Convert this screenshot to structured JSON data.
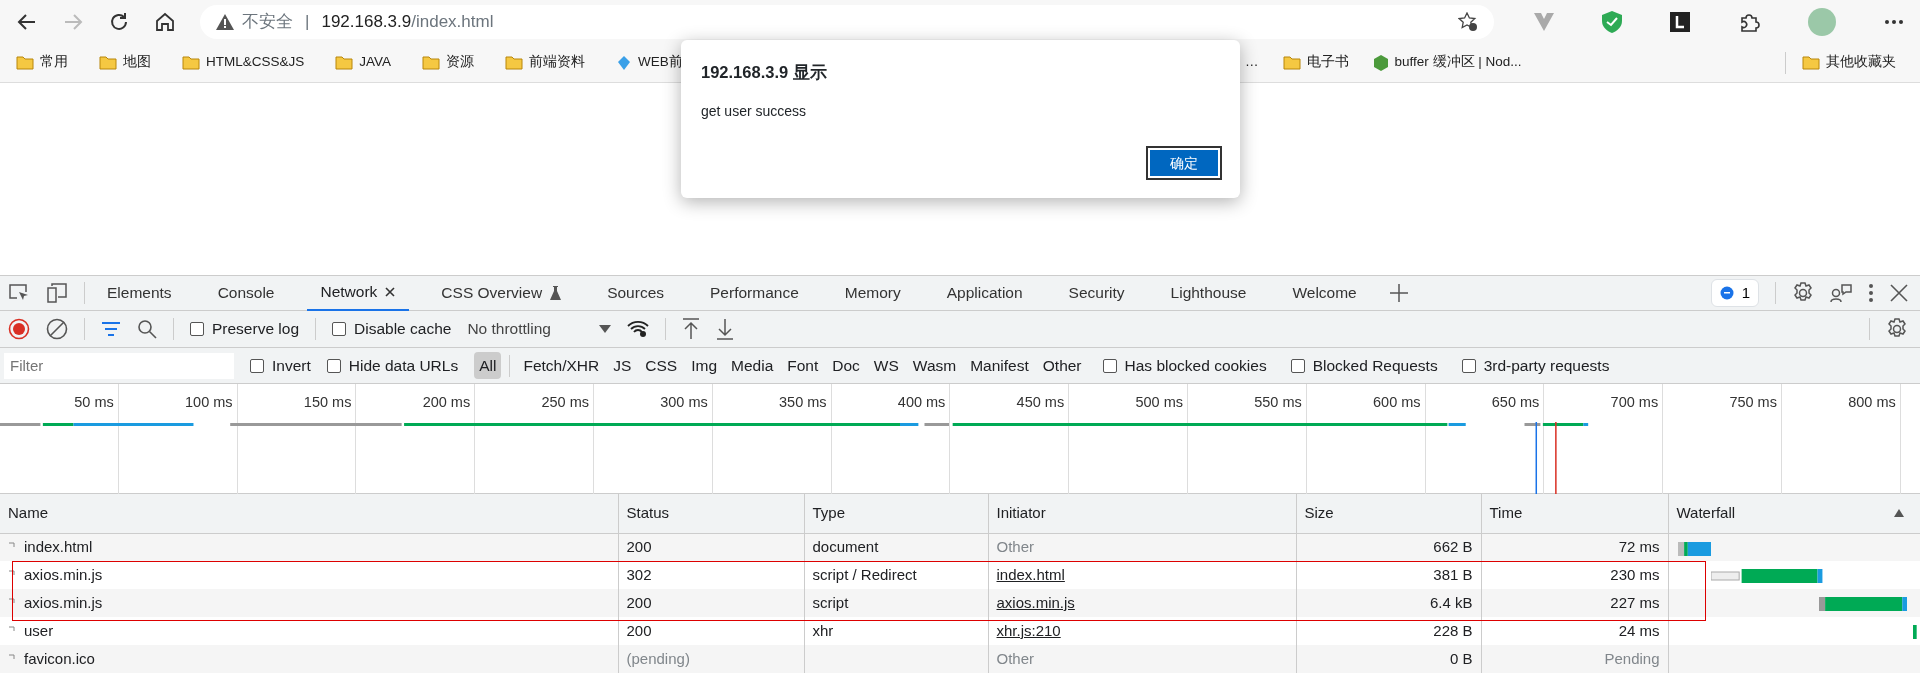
{
  "browser": {
    "address": {
      "security": "不安全",
      "separator": "|",
      "host": "192.168.3.9",
      "path": "/index.html"
    }
  },
  "bookmarks_left": [
    {
      "label": "常用",
      "kind": "folder"
    },
    {
      "label": "地图",
      "kind": "folder"
    },
    {
      "label": "HTML&CSS&JS",
      "kind": "folder"
    },
    {
      "label": "JAVA",
      "kind": "folder"
    },
    {
      "label": "资源",
      "kind": "folder"
    },
    {
      "label": "前端资料",
      "kind": "folder"
    },
    {
      "label": "WEB前",
      "kind": "site"
    }
  ],
  "bookmarks_right": [
    {
      "label": "…",
      "kind": "text"
    },
    {
      "label": "电子书",
      "kind": "folder"
    },
    {
      "label": "buffer 缓冲区 | Nod...",
      "kind": "node"
    }
  ],
  "other_bookmarks": "其他收藏夹",
  "dialog": {
    "title": "192.168.3.9 显示",
    "message": "get user success",
    "button": "确定"
  },
  "devtools": {
    "tabs": [
      {
        "label": "Elements",
        "selected": false,
        "experimental": false
      },
      {
        "label": "Console",
        "selected": false,
        "experimental": false
      },
      {
        "label": "Network",
        "selected": true,
        "experimental": false
      },
      {
        "label": "CSS Overview",
        "selected": false,
        "experimental": true
      },
      {
        "label": "Sources",
        "selected": false,
        "experimental": false
      },
      {
        "label": "Performance",
        "selected": false,
        "experimental": false
      },
      {
        "label": "Memory",
        "selected": false,
        "experimental": false
      },
      {
        "label": "Application",
        "selected": false,
        "experimental": false
      },
      {
        "label": "Security",
        "selected": false,
        "experimental": false
      },
      {
        "label": "Lighthouse",
        "selected": false,
        "experimental": false
      },
      {
        "label": "Welcome",
        "selected": false,
        "experimental": false
      }
    ],
    "issues_count": "1",
    "toolbar": {
      "preserve_log": {
        "label": "Preserve log",
        "checked": false
      },
      "disable_cache": {
        "label": "Disable cache",
        "checked": false
      },
      "throttling": "No throttling"
    },
    "filter": {
      "placeholder": "Filter",
      "options_left": [
        {
          "label": "Invert",
          "checked": false
        },
        {
          "label": "Hide data URLs",
          "checked": false
        }
      ],
      "types": [
        {
          "label": "All",
          "selected": true
        },
        {
          "label": "Fetch/XHR",
          "selected": false
        },
        {
          "label": "JS",
          "selected": false
        },
        {
          "label": "CSS",
          "selected": false
        },
        {
          "label": "Img",
          "selected": false
        },
        {
          "label": "Media",
          "selected": false
        },
        {
          "label": "Font",
          "selected": false
        },
        {
          "label": "Doc",
          "selected": false
        },
        {
          "label": "WS",
          "selected": false
        },
        {
          "label": "Wasm",
          "selected": false
        },
        {
          "label": "Manifest",
          "selected": false
        },
        {
          "label": "Other",
          "selected": false
        }
      ],
      "options_right": [
        {
          "label": "Has blocked cookies",
          "checked": false
        },
        {
          "label": "Blocked Requests",
          "checked": false
        },
        {
          "label": "3rd-party requests",
          "checked": false
        }
      ]
    },
    "timeline_ticks": [
      "50 ms",
      "100 ms",
      "150 ms",
      "200 ms",
      "250 ms",
      "300 ms",
      "350 ms",
      "400 ms",
      "450 ms",
      "500 ms",
      "550 ms",
      "600 ms",
      "650 ms",
      "700 ms",
      "750 ms",
      "800 ms"
    ],
    "table": {
      "columns": [
        "Name",
        "Status",
        "Type",
        "Initiator",
        "Size",
        "Time",
        "Waterfall"
      ],
      "rows": [
        {
          "name": "index.html",
          "status": "200",
          "type": "document",
          "initiator": {
            "text": "Other",
            "link": false
          },
          "size": "662 B",
          "time": "72 ms",
          "pending": false,
          "highlighted": false
        },
        {
          "name": "axios.min.js",
          "status": "302",
          "type": "script / Redirect",
          "initiator": {
            "text": "index.html",
            "link": true
          },
          "size": "381 B",
          "time": "230 ms",
          "pending": false,
          "highlighted": true
        },
        {
          "name": "axios.min.js",
          "status": "200",
          "type": "script",
          "initiator": {
            "text": "axios.min.js",
            "link": true
          },
          "size": "6.4 kB",
          "time": "227 ms",
          "pending": false,
          "highlighted": true
        },
        {
          "name": "user",
          "status": "200",
          "type": "xhr",
          "initiator": {
            "text": "xhr.js:210",
            "link": true
          },
          "size": "228 B",
          "time": "24 ms",
          "pending": false,
          "highlighted": false
        },
        {
          "name": "favicon.ico",
          "status": "(pending)",
          "initiator": {
            "text": "Other",
            "link": false
          },
          "size": "0 B",
          "time": "Pending",
          "pending": true,
          "highlighted": false
        }
      ]
    }
  }
}
